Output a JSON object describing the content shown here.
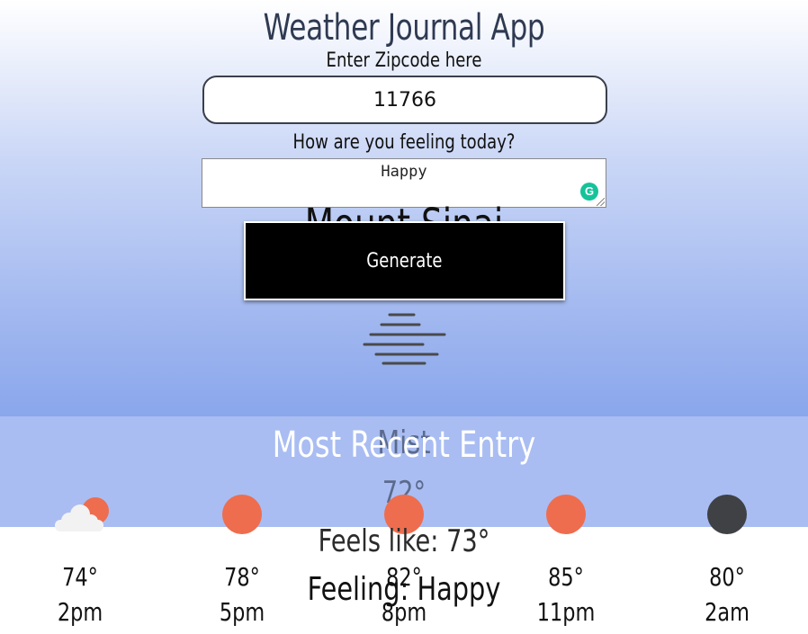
{
  "app": {
    "title": "Weather Journal App"
  },
  "form": {
    "zip_label": "Enter Zipcode here",
    "zip_value": "11766",
    "feelings_label": "How are you feeling today?",
    "feelings_value": "Happy",
    "generate_label": "Generate"
  },
  "weather": {
    "city": "Mount Sinai",
    "condition": "Mist",
    "temperature": "72°",
    "icon": "mist-icon"
  },
  "entry": {
    "title": "Most Recent Entry",
    "feels_like": "Feels like: 73°",
    "feeling": "Feeling: Happy"
  },
  "forecast": [
    {
      "temp": "74°",
      "time": "2pm",
      "icon": "partly-cloudy-icon"
    },
    {
      "temp": "78°",
      "time": "5pm",
      "icon": "sun-icon"
    },
    {
      "temp": "82°",
      "time": "8pm",
      "icon": "sun-icon"
    },
    {
      "temp": "85°",
      "time": "11pm",
      "icon": "sun-icon"
    },
    {
      "temp": "80°",
      "time": "2am",
      "icon": "moon-icon"
    }
  ],
  "colors": {
    "sun": "#ee6d4e",
    "moon": "#3f4145",
    "button_bg": "#000000",
    "band": "#a9bdf2",
    "grammarly": "#15c39a"
  }
}
